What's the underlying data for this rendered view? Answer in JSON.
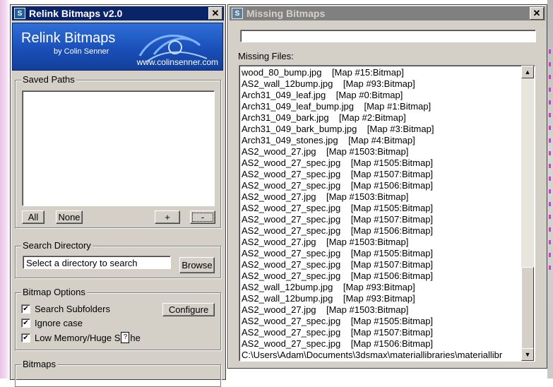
{
  "relink": {
    "title": "Relink Bitmaps v2.0",
    "icon": "3ds-max-icon",
    "banner": {
      "title": "Relink Bitmaps",
      "by": "by Colin Senner",
      "url": "www.colinsenner.com"
    },
    "saved_paths": {
      "label": "Saved Paths",
      "all": "All",
      "none": "None",
      "add": "+",
      "remove": "-"
    },
    "search_directory": {
      "label": "Search Directory",
      "placeholder": "Select a directory to search",
      "browse": "Browse"
    },
    "bitmap_options": {
      "label": "Bitmap Options",
      "search_subfolders": "Search Subfolders",
      "ignore_case": "Ignore case",
      "low_memory": "Low Memory/Huge S",
      "low_memory_tail": "he",
      "configure": "Configure",
      "check": "✔"
    },
    "bitmaps_label": "Bitmaps"
  },
  "missing": {
    "title": "Missing Bitmaps",
    "missing_files_label": "Missing Files:",
    "files": [
      [
        "wood_80_bump.jpg",
        "[Map #15:Bitmap]"
      ],
      [
        "AS2_wall_12bump.jpg",
        "[Map #93:Bitmap]"
      ],
      [
        "Arch31_049_leaf.jpg",
        "[Map #0:Bitmap]"
      ],
      [
        "Arch31_049_leaf_bump.jpg",
        "[Map #1:Bitmap]"
      ],
      [
        "Arch31_049_bark.jpg",
        "[Map #2:Bitmap]"
      ],
      [
        "Arch31_049_bark_bump.jpg",
        "[Map #3:Bitmap]"
      ],
      [
        "Arch31_049_stones.jpg",
        "[Map #4:Bitmap]"
      ],
      [
        "AS2_wood_27.jpg",
        "[Map #1503:Bitmap]"
      ],
      [
        "AS2_wood_27_spec.jpg",
        "[Map #1505:Bitmap]"
      ],
      [
        "AS2_wood_27_spec.jpg",
        "[Map #1507:Bitmap]"
      ],
      [
        "AS2_wood_27_spec.jpg",
        "[Map #1506:Bitmap]"
      ],
      [
        "AS2_wood_27.jpg",
        "[Map #1503:Bitmap]"
      ],
      [
        "AS2_wood_27_spec.jpg",
        "[Map #1505:Bitmap]"
      ],
      [
        "AS2_wood_27_spec.jpg",
        "[Map #1507:Bitmap]"
      ],
      [
        "AS2_wood_27_spec.jpg",
        "[Map #1506:Bitmap]"
      ],
      [
        "AS2_wood_27.jpg",
        "[Map #1503:Bitmap]"
      ],
      [
        "AS2_wood_27_spec.jpg",
        "[Map #1505:Bitmap]"
      ],
      [
        "AS2_wood_27_spec.jpg",
        "[Map #1507:Bitmap]"
      ],
      [
        "AS2_wood_27_spec.jpg",
        "[Map #1506:Bitmap]"
      ],
      [
        "AS2_wall_12bump.jpg",
        "[Map #93:Bitmap]"
      ],
      [
        "AS2_wall_12bump.jpg",
        "[Map #93:Bitmap]"
      ],
      [
        "AS2_wood_27.jpg",
        "[Map #1503:Bitmap]"
      ],
      [
        "AS2_wood_27_spec.jpg",
        "[Map #1505:Bitmap]"
      ],
      [
        "AS2_wood_27_spec.jpg",
        "[Map #1507:Bitmap]"
      ],
      [
        "AS2_wood_27_spec.jpg",
        "[Map #1506:Bitmap]"
      ]
    ],
    "path_line": "C:\\Users\\Adam\\Documents\\3dsmax\\materiallibraries\\materiallibr"
  },
  "icons": {
    "close": "✕",
    "scroll_up": "▲",
    "scroll_down": "▼",
    "app": "S"
  }
}
